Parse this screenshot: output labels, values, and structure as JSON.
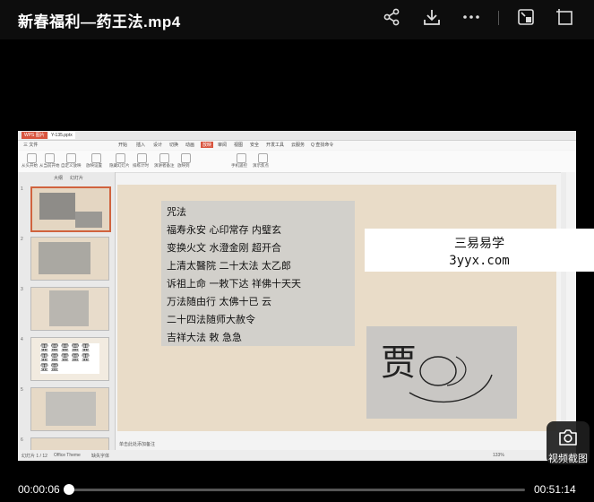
{
  "header": {
    "title": "新春福利—药王法.mp4",
    "icons": [
      "share-icon",
      "download-icon",
      "more-icon",
      "picture-in-picture-icon",
      "window-mode-icon"
    ]
  },
  "wps": {
    "tabs": [
      "WPS 图片",
      "Y-135.pptx"
    ],
    "menu": [
      "三 文件",
      "开始",
      "插入",
      "设计",
      "切换",
      "动画",
      "放映",
      "审阅",
      "视图",
      "安全",
      "开发工具",
      "云服务",
      "Q 查找命令"
    ],
    "toolbar": [
      "从头开始",
      "从当前开始",
      "自定义放映",
      "放映设置",
      "隐藏幻灯片",
      "排练计时",
      "演讲者备注",
      "放映到",
      "手机遥控",
      "演示焦点"
    ],
    "sidebar_tabs": [
      "大纲",
      "幻灯片"
    ],
    "status": [
      "幻灯片 1 / 12",
      "Office Theme",
      "缺失字体",
      "单击此处添加备注",
      "133%"
    ],
    "thumb_numbers": [
      "1",
      "2",
      "3",
      "4",
      "5",
      "6"
    ]
  },
  "slide": {
    "note_lines": [
      "咒法",
      "福寿永安 心印常存 内璧玄",
      "变换火文 水澄金刚 超开合",
      "上清太醫院 二十太法 太乙郎",
      "诉祖上命 一敕下达 祥佛十天天",
      "万法随由行 太佛十已 云",
      "二十四法随师大赦令",
      "吉祥大法 敕 急急"
    ],
    "seal_text": "贾"
  },
  "watermark": {
    "line1": "三易易学",
    "line2": "3yyx.com"
  },
  "screenshot_button": {
    "label": "视频截图",
    "icon": "camera-icon"
  },
  "playback": {
    "current": "00:00:06",
    "total": "00:51:14",
    "progress_fraction": 0.002
  }
}
